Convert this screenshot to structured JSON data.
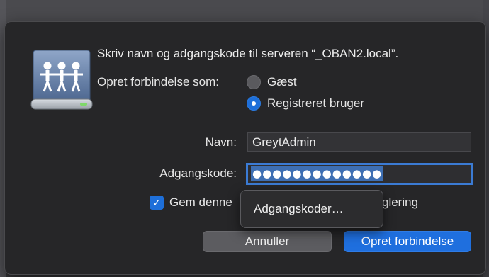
{
  "dialog": {
    "message": "Skriv navn og adgangskode til serveren “_OBAN2.local”.",
    "connect_as_label": "Opret forbindelse som:",
    "radio_guest": "Gæst",
    "radio_registered": "Registreret bruger",
    "selected_radio": "registered",
    "name_label": "Navn:",
    "name_value": "GreytAdmin",
    "password_label": "Adgangskode:",
    "password_masked": "●●●●●●●●●●●●●",
    "remember_checkbox_label_visible": "Gem denne",
    "remember_checkbox_label_tail": "glering",
    "remember_checked": true,
    "popup_item": "Adgangskoder…",
    "cancel_button": "Annuller",
    "connect_button": "Opret forbindelse"
  },
  "icons": {
    "server": "shared-server-icon",
    "checkmark": "checkmark-icon"
  },
  "colors": {
    "accent": "#1f6fde",
    "dialog_bg": "#262628",
    "text": "#e6e6e6"
  }
}
